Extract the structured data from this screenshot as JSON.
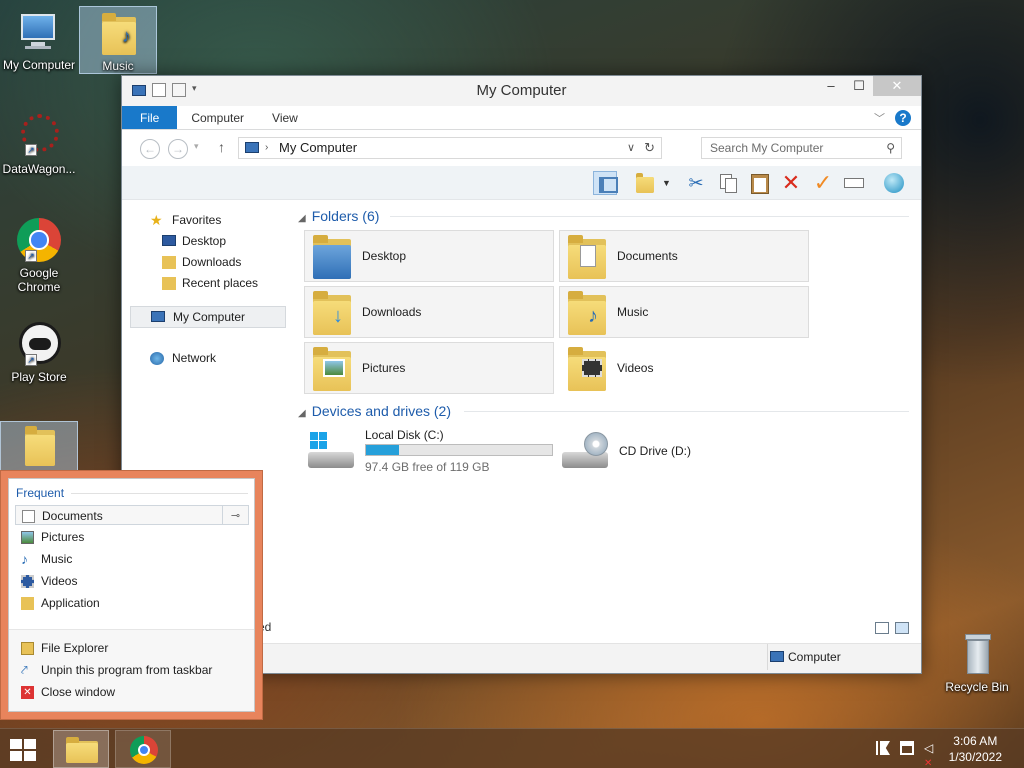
{
  "desktop": {
    "icons": [
      {
        "label": "My Computer"
      },
      {
        "label": "Music"
      },
      {
        "label": "DataWagon..."
      },
      {
        "label": "Google Chrome"
      },
      {
        "label": "Play Store"
      },
      {
        "label": ""
      },
      {
        "label": "Recycle Bin"
      }
    ]
  },
  "window": {
    "title": "My Computer",
    "controls": {
      "minimize": "–",
      "maximize": "☐",
      "close": "✕"
    },
    "ribbon_tabs": [
      "File",
      "Computer",
      "View"
    ],
    "address": {
      "path": "My Computer",
      "separator": "›"
    },
    "search": {
      "placeholder": "Search My Computer"
    },
    "nav": {
      "favorites": "Favorites",
      "favorites_items": [
        "Desktop",
        "Downloads",
        "Recent places"
      ],
      "computer": "My Computer",
      "network": "Network"
    },
    "folders": {
      "header": "Folders (6)",
      "items": [
        "Desktop",
        "Documents",
        "Downloads",
        "Music",
        "Pictures",
        "Videos"
      ]
    },
    "devices": {
      "header": "Devices and drives (2)",
      "local_disk": {
        "name": "Local Disk (C:)",
        "free": "97.4 GB free of 119 GB",
        "used_fraction": 0.18
      },
      "cd": {
        "name": "CD Drive (D:)"
      }
    },
    "status": {
      "left": "ected",
      "location": "Computer"
    }
  },
  "jumplist": {
    "header": "Frequent",
    "frequent": [
      "Documents",
      "Pictures",
      "Music",
      "Videos",
      "Application"
    ],
    "tasks": [
      "File Explorer",
      "Unpin this program from taskbar",
      "Close window"
    ]
  },
  "taskbar": {
    "time": "3:06 AM",
    "date": "1/30/2022"
  },
  "colors": {
    "accent": "#1979ca",
    "jumplist_border": "#e8845c",
    "progress": "#26a0da"
  }
}
